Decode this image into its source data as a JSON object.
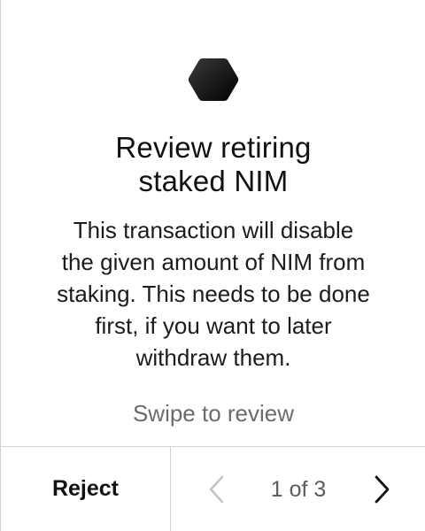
{
  "review": {
    "icon": "nimiq-hexagon-icon",
    "title_lines": [
      "Review retiring",
      "staked NIM"
    ],
    "description_lines": [
      "This transaction will disable",
      "the given amount of NIM from",
      "staking. This needs to be done",
      "first, if you want to later",
      "withdraw them."
    ],
    "hint": "Swipe to review"
  },
  "footer": {
    "reject_label": "Reject",
    "page_indicator": "1 of 3",
    "prev_icon": "chevron-left-icon",
    "next_icon": "chevron-right-icon",
    "prev_enabled": false,
    "next_enabled": true
  },
  "colors": {
    "text": "#111111",
    "hint": "#6b6b6b",
    "disabled_icon": "#c4c4c4",
    "divider": "#d4d4d4"
  }
}
